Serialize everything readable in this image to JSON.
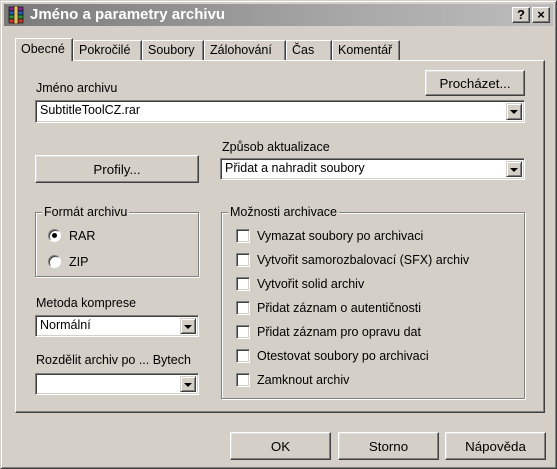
{
  "window": {
    "title": "Jméno a parametry archivu",
    "help_button": "?",
    "close_button": "×"
  },
  "tabs": [
    {
      "label": "Obecné",
      "active": true
    },
    {
      "label": "Pokročilé"
    },
    {
      "label": "Soubory"
    },
    {
      "label": "Zálohování"
    },
    {
      "label": "Čas"
    },
    {
      "label": "Komentář"
    }
  ],
  "general": {
    "archive_name_label": "Jméno archivu",
    "browse_button": "Procházet...",
    "archive_name_value": "SubtitleToolCZ.rar",
    "profiles_button": "Profily...",
    "update_mode_label": "Způsob aktualizace",
    "update_mode_value": "Přidat a nahradit soubory",
    "archive_format": {
      "title": "Formát archivu",
      "options": [
        {
          "label": "RAR",
          "selected": true
        },
        {
          "label": "ZIP",
          "selected": false
        }
      ]
    },
    "compression_label": "Metoda komprese",
    "compression_value": "Normální",
    "split_label": "Rozdělit archiv po ... Bytech",
    "split_value": "",
    "archiving_options": {
      "title": "Možnosti archivace",
      "items": [
        {
          "label": "Vymazat soubory po archivaci",
          "checked": false
        },
        {
          "label": "Vytvořit samorozbalovací (SFX) archiv",
          "checked": false
        },
        {
          "label": "Vytvořit solid archiv",
          "checked": false
        },
        {
          "label": "Přidat záznam o autentičnosti",
          "checked": false
        },
        {
          "label": "Přidat záznam pro opravu dat",
          "checked": false
        },
        {
          "label": "Otestovat soubory po archivaci",
          "checked": false
        },
        {
          "label": "Zamknout archiv",
          "checked": false
        }
      ]
    }
  },
  "footer": {
    "ok": "OK",
    "cancel": "Storno",
    "help": "Nápověda"
  },
  "colors": {
    "face": "#d4d0c8",
    "titlebar_inactive": "#808080"
  }
}
